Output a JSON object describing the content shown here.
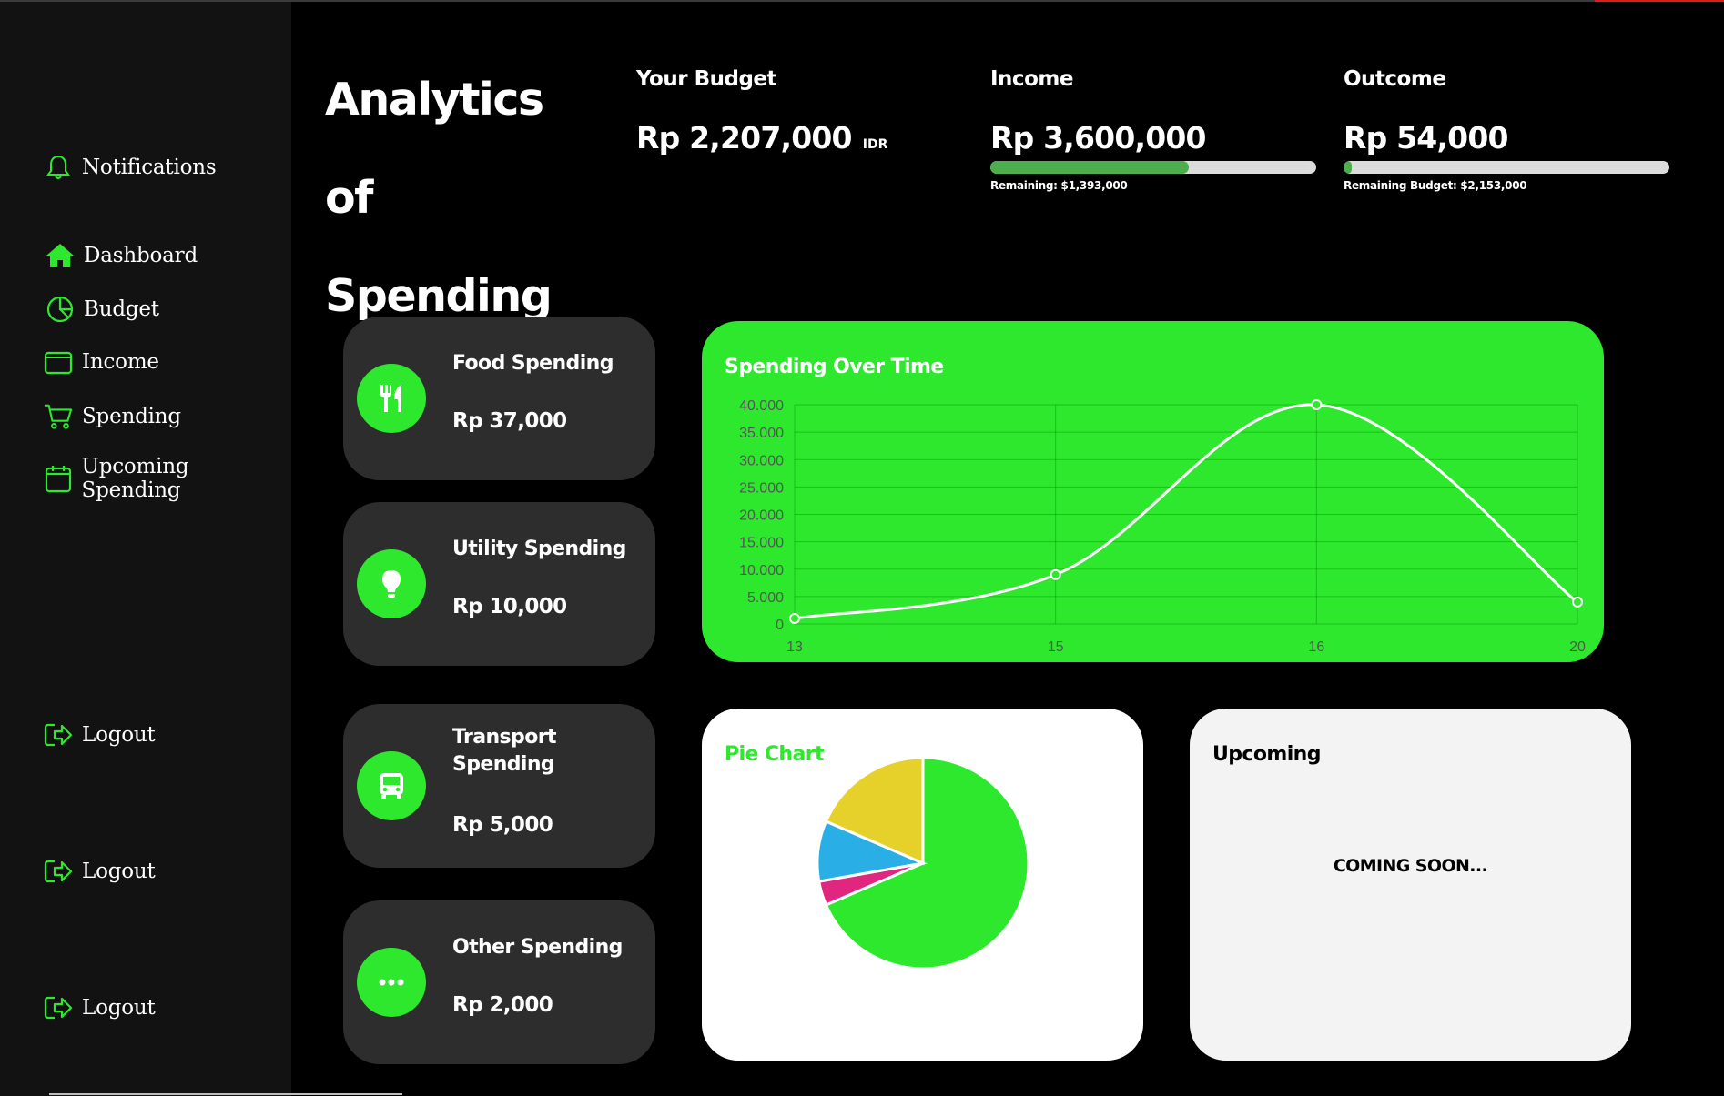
{
  "sidebar": {
    "notifications": {
      "label": "Notifications",
      "icon": "bell-icon"
    },
    "items": [
      {
        "label": "Dashboard",
        "icon": "home-icon"
      },
      {
        "label": "Budget",
        "icon": "pie-chart-icon"
      },
      {
        "label": "Income",
        "icon": "wallet-icon"
      },
      {
        "label": "Spending",
        "icon": "cart-icon"
      },
      {
        "label": "Upcoming Spending",
        "icon": "calendar-icon"
      }
    ],
    "logout": [
      "Logout",
      "Logout",
      "Logout"
    ]
  },
  "header": {
    "title_line1": "Analytics of",
    "title_line2": "Spending",
    "budget": {
      "label": "Your Budget",
      "value": "Rp 2,207,000",
      "unit": "IDR"
    },
    "income": {
      "label": "Income",
      "value": "Rp 3,600,000",
      "remaining": "Remaining: $1,393,000",
      "progress": 0.61
    },
    "outcome": {
      "label": "Outcome",
      "value": "Rp 54,000",
      "remaining": "Remaining Budget: $2,153,000",
      "progress": 0.02
    }
  },
  "cards": [
    {
      "title": "Food Spending",
      "value": "Rp 37,000",
      "icon": "utensils-icon"
    },
    {
      "title": "Utility Spending",
      "value": "Rp 10,000",
      "icon": "lightbulb-icon"
    },
    {
      "title": "Transport Spending",
      "value": "Rp 5,000",
      "icon": "bus-icon"
    },
    {
      "title": "Other Spending",
      "value": "Rp 2,000",
      "icon": "ellipsis-icon"
    }
  ],
  "colors": {
    "accent": "#2ee82e",
    "card_bg": "#2d2d2d",
    "sidebar_bg": "#121212",
    "progress_fill": "#4cae4c"
  },
  "upcoming": {
    "title": "Upcoming",
    "message": "COMING SOON..."
  },
  "chart_data": [
    {
      "type": "line",
      "title": "Spending Over Time",
      "x": [
        "13",
        "15",
        "16",
        "20"
      ],
      "y_tick_labels": [
        "0",
        "5.000",
        "10.000",
        "15.000",
        "20.000",
        "25.000",
        "30.000",
        "35.000",
        "40.000"
      ],
      "series": [
        {
          "values": [
            1000,
            9000,
            40000,
            4000
          ]
        }
      ],
      "ylim": [
        0,
        40000
      ],
      "grid": true,
      "smooth": true
    },
    {
      "type": "pie",
      "title": "Pie Chart",
      "slices": [
        {
          "value": 37000,
          "color": "#2ee82e"
        },
        {
          "value": 2000,
          "color": "#e0267f"
        },
        {
          "value": 5000,
          "color": "#2aaee6"
        },
        {
          "value": 10000,
          "color": "#e6d02a"
        }
      ]
    }
  ]
}
